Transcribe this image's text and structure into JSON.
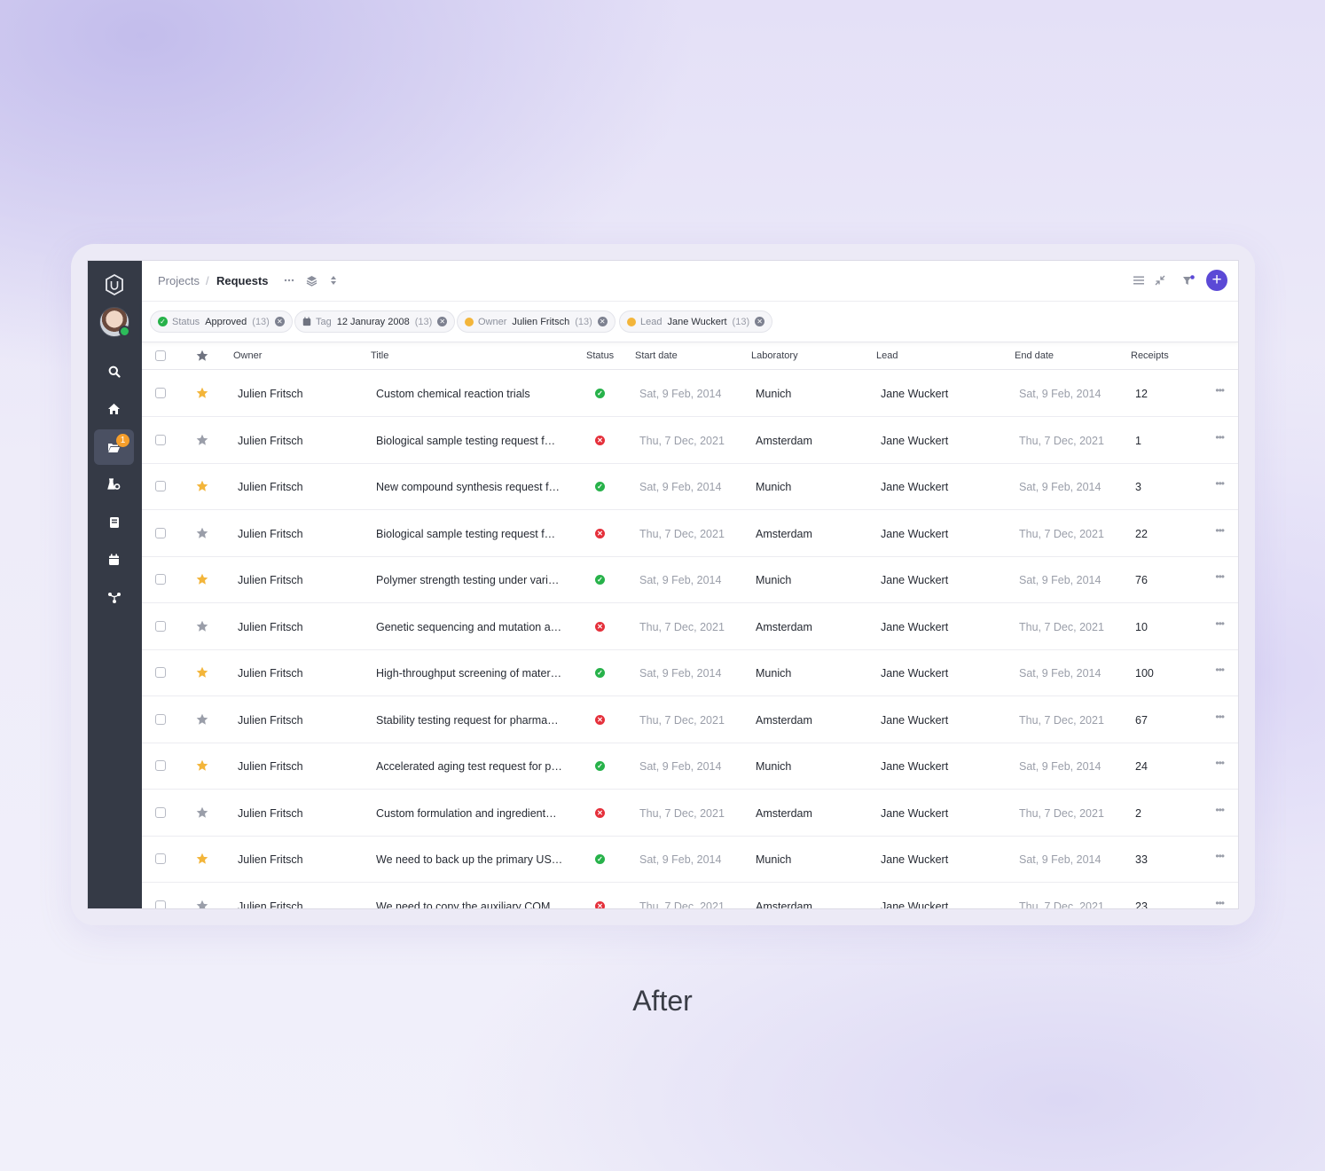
{
  "breadcrumb": {
    "projects": "Projects",
    "separator": "/",
    "current": "Requests"
  },
  "filters": [
    {
      "key": "Status",
      "value": "Approved",
      "count": "(13)",
      "icon": "check-circle-icon"
    },
    {
      "key": "Tag",
      "value": "12 Januray 2008",
      "count": "(13)",
      "icon": "calendar-icon"
    },
    {
      "key": "Owner",
      "value": "Julien Fritsch",
      "count": "(13)",
      "icon": "yellow-dot-icon"
    },
    {
      "key": "Lead",
      "value": "Jane Wuckert",
      "count": "(13)",
      "icon": "yellow-dot-icon"
    }
  ],
  "sidebar": {
    "badge": "1"
  },
  "columns": {
    "owner": "Owner",
    "title": "Title",
    "status": "Status",
    "start": "Start date",
    "lab": "Laboratory",
    "lead": "Lead",
    "end": "End date",
    "receipts": "Receipts"
  },
  "rows": [
    {
      "owner": "Julien Fritsch",
      "title": "Custom chemical reaction trials",
      "status": "ok",
      "starred": true,
      "start": "Sat, 9 Feb, 2014",
      "lab": "Munich",
      "lead": "Jane Wuckert",
      "end": "Sat, 9 Feb, 2014",
      "receipts": "12"
    },
    {
      "owner": "Julien Fritsch",
      "title": "Biological sample testing request f…",
      "status": "err",
      "starred": false,
      "start": "Thu, 7 Dec, 2021",
      "lab": "Amsterdam",
      "lead": "Jane Wuckert",
      "end": "Thu, 7 Dec, 2021",
      "receipts": "1"
    },
    {
      "owner": "Julien Fritsch",
      "title": "New compound synthesis request f…",
      "status": "ok",
      "starred": true,
      "start": "Sat, 9 Feb, 2014",
      "lab": "Munich",
      "lead": "Jane Wuckert",
      "end": "Sat, 9 Feb, 2014",
      "receipts": "3"
    },
    {
      "owner": "Julien Fritsch",
      "title": "Biological sample testing request f…",
      "status": "err",
      "starred": false,
      "start": "Thu, 7 Dec, 2021",
      "lab": "Amsterdam",
      "lead": "Jane Wuckert",
      "end": "Thu, 7 Dec, 2021",
      "receipts": "22"
    },
    {
      "owner": "Julien Fritsch",
      "title": "Polymer strength testing under vari…",
      "status": "ok",
      "starred": true,
      "start": "Sat, 9 Feb, 2014",
      "lab": "Munich",
      "lead": "Jane Wuckert",
      "end": "Sat, 9 Feb, 2014",
      "receipts": "76"
    },
    {
      "owner": "Julien Fritsch",
      "title": "Genetic sequencing and mutation a…",
      "status": "err",
      "starred": false,
      "start": "Thu, 7 Dec, 2021",
      "lab": "Amsterdam",
      "lead": "Jane Wuckert",
      "end": "Thu, 7 Dec, 2021",
      "receipts": "10"
    },
    {
      "owner": "Julien Fritsch",
      "title": "High-throughput screening of mater…",
      "status": "ok",
      "starred": true,
      "start": "Sat, 9 Feb, 2014",
      "lab": "Munich",
      "lead": "Jane Wuckert",
      "end": "Sat, 9 Feb, 2014",
      "receipts": "100"
    },
    {
      "owner": "Julien Fritsch",
      "title": "Stability testing request for pharma…",
      "status": "err",
      "starred": false,
      "start": "Thu, 7 Dec, 2021",
      "lab": "Amsterdam",
      "lead": "Jane Wuckert",
      "end": "Thu, 7 Dec, 2021",
      "receipts": "67"
    },
    {
      "owner": "Julien Fritsch",
      "title": "Accelerated aging test request for p…",
      "status": "ok",
      "starred": true,
      "start": "Sat, 9 Feb, 2014",
      "lab": "Munich",
      "lead": "Jane Wuckert",
      "end": "Sat, 9 Feb, 2014",
      "receipts": "24"
    },
    {
      "owner": "Julien Fritsch",
      "title": "Custom formulation and ingredient…",
      "status": "err",
      "starred": false,
      "start": "Thu, 7 Dec, 2021",
      "lab": "Amsterdam",
      "lead": "Jane Wuckert",
      "end": "Thu, 7 Dec, 2021",
      "receipts": "2"
    },
    {
      "owner": "Julien Fritsch",
      "title": "We need to back up the primary US…",
      "status": "ok",
      "starred": true,
      "start": "Sat, 9 Feb, 2014",
      "lab": "Munich",
      "lead": "Jane Wuckert",
      "end": "Sat, 9 Feb, 2014",
      "receipts": "33"
    },
    {
      "owner": "Julien Fritsch",
      "title": "We need to copy the auxiliary COM…",
      "status": "err",
      "starred": false,
      "start": "Thu, 7 Dec, 2021",
      "lab": "Amsterdam",
      "lead": "Jane Wuckert",
      "end": "Thu, 7 Dec, 2021",
      "receipts": "23"
    }
  ],
  "colors": {
    "accent": "#5b49d6",
    "ok": "#27b24a",
    "err": "#e5303b",
    "star_on": "#f3b53a",
    "star_off": "#9a9ea9",
    "sidebar": "#353a46"
  },
  "caption": "After"
}
